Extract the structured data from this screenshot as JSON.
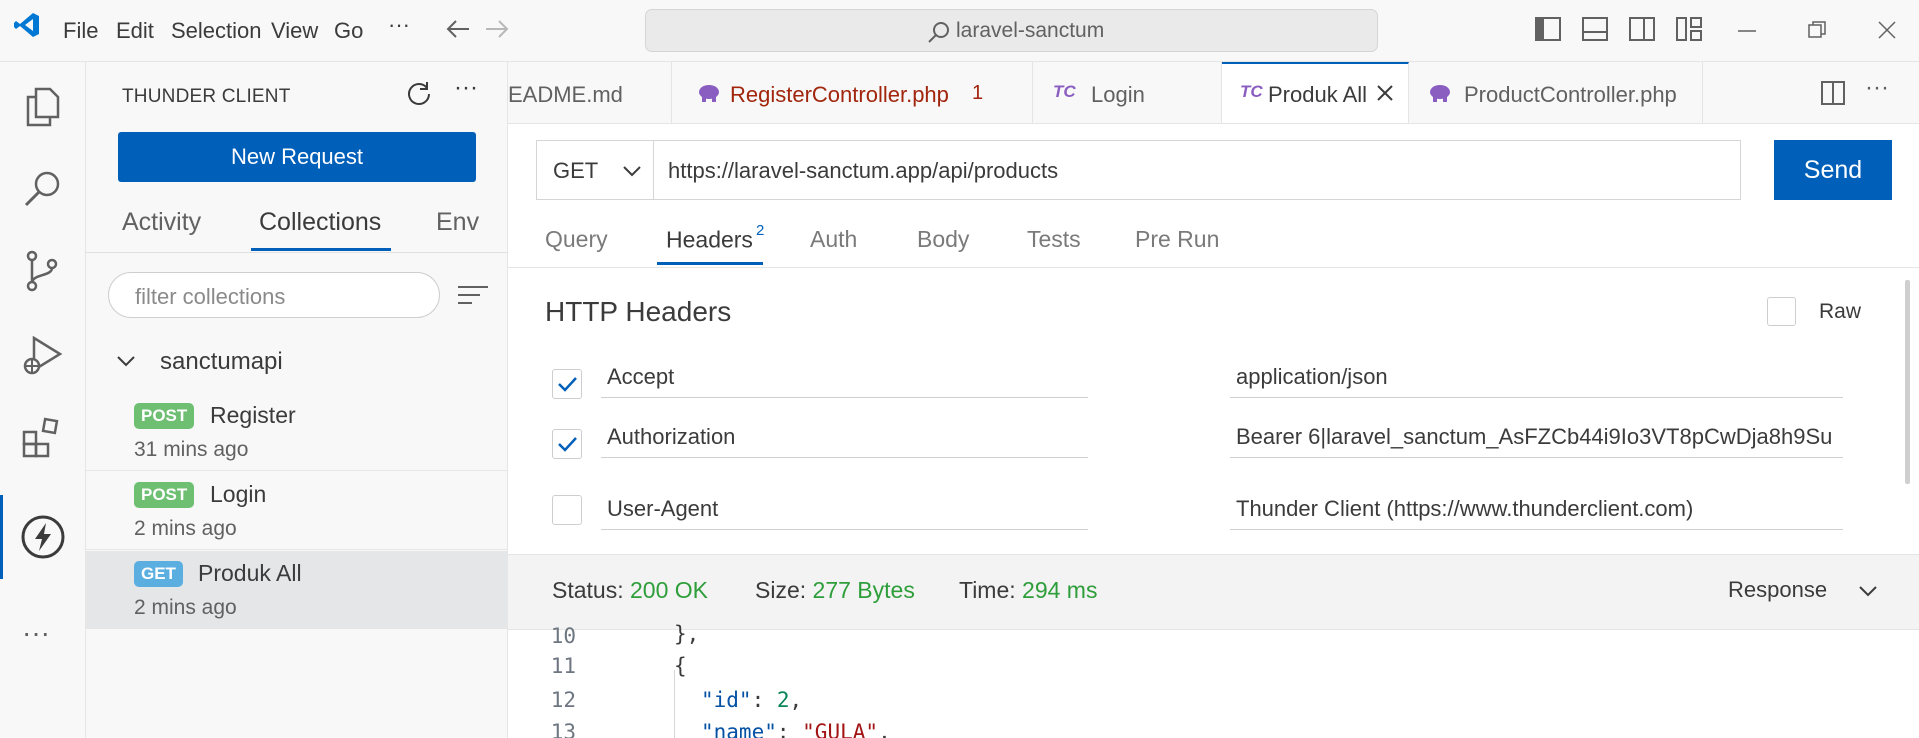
{
  "titlebar": {
    "menu": [
      "File",
      "Edit",
      "Selection",
      "View",
      "Go"
    ],
    "more_label": "···",
    "search_text": "laravel-sanctum"
  },
  "sidebar": {
    "title": "THUNDER CLIENT",
    "new_request_label": "New Request",
    "tabs": [
      "Activity",
      "Collections",
      "Env"
    ],
    "active_tab": "Collections",
    "filter_placeholder": "filter collections",
    "collection": {
      "name": "sanctumapi",
      "requests": [
        {
          "method": "POST",
          "name": "Register",
          "time": "31 mins ago"
        },
        {
          "method": "POST",
          "name": "Login",
          "time": "2 mins ago"
        },
        {
          "method": "GET",
          "name": "Produk All",
          "time": "2 mins ago"
        }
      ]
    }
  },
  "editor_tabs": [
    {
      "label": "EADME.md",
      "icon": "none"
    },
    {
      "label": "RegisterController.php",
      "badge": "1",
      "icon": "php-elephant-icon"
    },
    {
      "label": "Login",
      "icon": "tc-icon"
    },
    {
      "label": "Produk All",
      "icon": "tc-icon",
      "active": true
    },
    {
      "label": "ProductController.php",
      "icon": "php-elephant-icon"
    }
  ],
  "request": {
    "method": "GET",
    "url": "https://laravel-sanctum.app/api/products",
    "send_label": "Send",
    "tabs": [
      "Query",
      "Headers",
      "Auth",
      "Body",
      "Tests",
      "Pre Run"
    ],
    "headers_count": "2",
    "active_tab": "Headers"
  },
  "headers_panel": {
    "title": "HTTP Headers",
    "raw_label": "Raw",
    "rows": [
      {
        "checked": true,
        "key": "Accept",
        "value": "application/json"
      },
      {
        "checked": true,
        "key": "Authorization",
        "value": "Bearer 6|laravel_sanctum_AsFZCb44i9Io3VT8pCwDja8h9Su"
      },
      {
        "checked": false,
        "key": "User-Agent",
        "value": "Thunder Client (https://www.thunderclient.com)"
      }
    ]
  },
  "response_status": {
    "status_label": "Status:",
    "status_value": "200 OK",
    "size_label": "Size:",
    "size_value": "277 Bytes",
    "time_label": "Time:",
    "time_value": "294 ms",
    "dropdown_label": "Response"
  },
  "code": {
    "line_numbers": [
      "10",
      "11",
      "12",
      "13"
    ],
    "line10": "},",
    "line11": "{",
    "line12_key": "\"id\"",
    "line12_value": "2",
    "line13_key": "\"name\"",
    "line13_value": "\"GULA\""
  },
  "colors": {
    "accent": "#005fb8",
    "success": "#2e9e3a",
    "post_badge": "#6fbf73",
    "get_badge": "#5aaee0",
    "error_tab": "#a1260d"
  }
}
